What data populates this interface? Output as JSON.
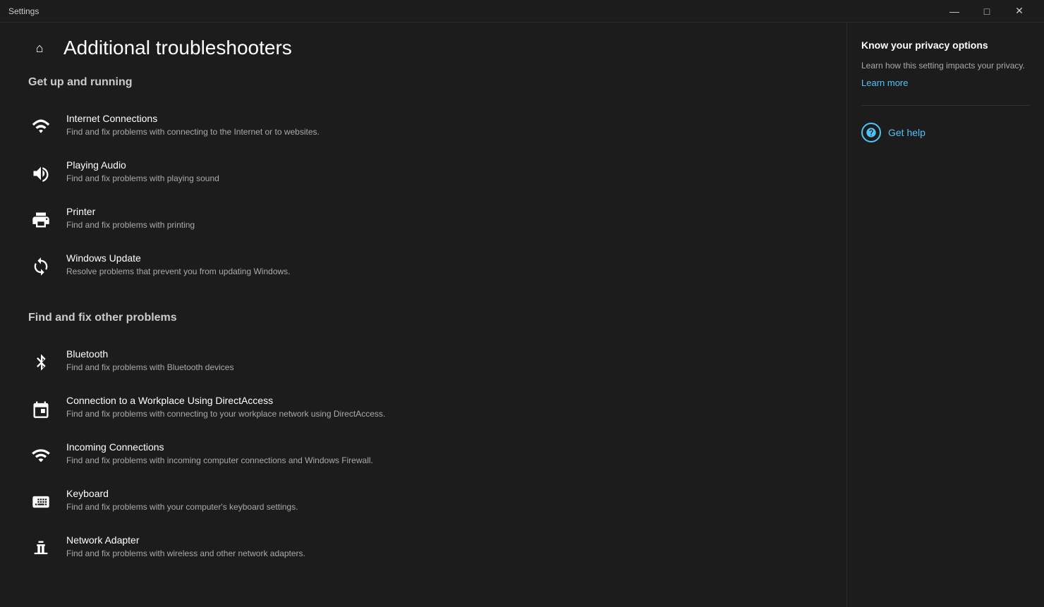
{
  "window": {
    "title": "Settings",
    "controls": {
      "minimize": "—",
      "maximize": "□",
      "close": "✕"
    }
  },
  "header": {
    "page_title": "Additional troubleshooters"
  },
  "sections": [
    {
      "id": "get-up-running",
      "title": "Get up and running",
      "items": [
        {
          "name": "Internet Connections",
          "desc": "Find and fix problems with connecting to the Internet or to websites.",
          "icon": "wifi"
        },
        {
          "name": "Playing Audio",
          "desc": "Find and fix problems with playing sound",
          "icon": "audio"
        },
        {
          "name": "Printer",
          "desc": "Find and fix problems with printing",
          "icon": "printer"
        },
        {
          "name": "Windows Update",
          "desc": "Resolve problems that prevent you from updating Windows.",
          "icon": "update"
        }
      ]
    },
    {
      "id": "find-fix-other",
      "title": "Find and fix other problems",
      "items": [
        {
          "name": "Bluetooth",
          "desc": "Find and fix problems with Bluetooth devices",
          "icon": "bluetooth"
        },
        {
          "name": "Connection to a Workplace Using DirectAccess",
          "desc": "Find and fix problems with connecting to your workplace network using DirectAccess.",
          "icon": "workplace"
        },
        {
          "name": "Incoming Connections",
          "desc": "Find and fix problems with incoming computer connections and Windows Firewall.",
          "icon": "incoming"
        },
        {
          "name": "Keyboard",
          "desc": "Find and fix problems with your computer's keyboard settings.",
          "icon": "keyboard"
        },
        {
          "name": "Network Adapter",
          "desc": "Find and fix problems with wireless and other network adapters.",
          "icon": "network"
        }
      ]
    }
  ],
  "sidebar": {
    "privacy_title": "Know your privacy options",
    "privacy_desc": "Learn how this setting impacts your privacy.",
    "learn_more_label": "Learn more",
    "get_help_label": "Get help"
  }
}
